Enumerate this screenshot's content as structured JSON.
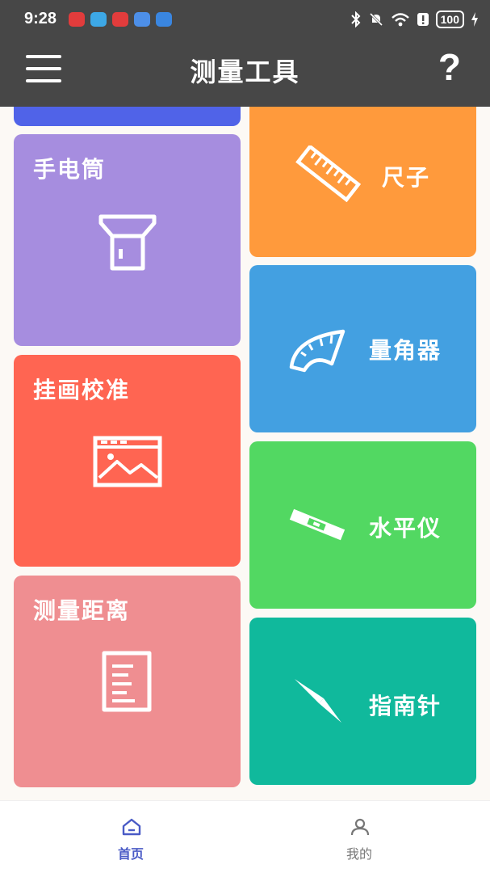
{
  "status": {
    "time": "9:28",
    "battery": "100"
  },
  "appbar": {
    "title": "测量工具",
    "help_label": "?"
  },
  "tools": {
    "flashlight": "手电筒",
    "ruler": "尺子",
    "protractor": "量角器",
    "picture_level": "挂画校准",
    "level": "水平仪",
    "distance": "测量距离",
    "compass": "指南针"
  },
  "colors": {
    "blue_top": "#5063e8",
    "flashlight": "#a68ddf",
    "ruler": "#ff9a3c",
    "protractor": "#43a0e1",
    "picture_level": "#ff6552",
    "level": "#52d862",
    "distance": "#ef8e91",
    "compass": "#10b99c",
    "nav_active": "#4a5bc6",
    "nav_inactive": "#777777"
  },
  "nav": {
    "home": "首页",
    "mine": "我的"
  }
}
